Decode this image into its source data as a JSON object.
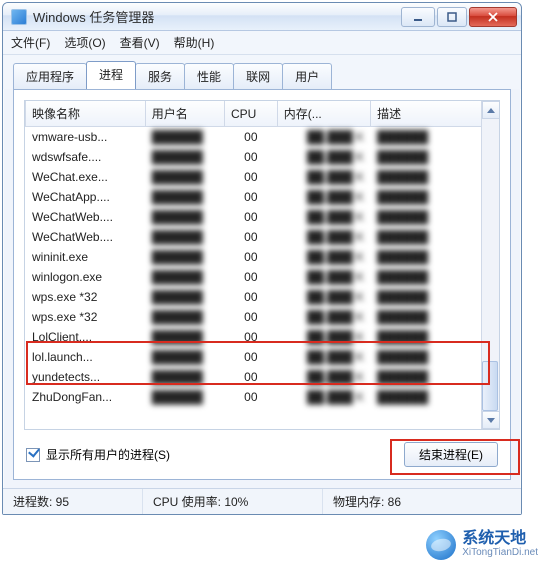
{
  "window": {
    "title": "Windows 任务管理器"
  },
  "menu": {
    "file": "文件(F)",
    "options": "选项(O)",
    "view": "查看(V)",
    "help": "帮助(H)"
  },
  "tabs": {
    "applications": "应用程序",
    "processes": "进程",
    "services": "服务",
    "performance": "性能",
    "networking": "联网",
    "users": "用户"
  },
  "columns": {
    "image_name": "映像名称",
    "user_name": "用户名",
    "cpu": "CPU",
    "memory": "内存(...",
    "description": "描述"
  },
  "rows": [
    {
      "name": "vmware-usb...",
      "cpu": "00"
    },
    {
      "name": "wdswfsafe....",
      "cpu": "00"
    },
    {
      "name": "WeChat.exe...",
      "cpu": "00"
    },
    {
      "name": "WeChatApp....",
      "cpu": "00"
    },
    {
      "name": "WeChatWeb....",
      "cpu": "00"
    },
    {
      "name": "WeChatWeb....",
      "cpu": "00"
    },
    {
      "name": "wininit.exe",
      "cpu": "00"
    },
    {
      "name": "winlogon.exe",
      "cpu": "00"
    },
    {
      "name": "wps.exe *32",
      "cpu": "00"
    },
    {
      "name": "wps.exe *32",
      "cpu": "00"
    },
    {
      "name": "LolClient....",
      "cpu": "00"
    },
    {
      "name": "lol.launch...",
      "cpu": "00"
    },
    {
      "name": "yundetects...",
      "cpu": "00"
    },
    {
      "name": "ZhuDongFan...",
      "cpu": "00"
    }
  ],
  "footer": {
    "show_all_label": "显示所有用户的进程(S)",
    "end_process_label": "结束进程(E)"
  },
  "status": {
    "process_count": "进程数: 95",
    "cpu_usage": "CPU 使用率: 10%",
    "physical_memory": "物理内存: 86"
  },
  "logo": {
    "cn": "系统天地",
    "en": "XiTongTianDi.net"
  }
}
